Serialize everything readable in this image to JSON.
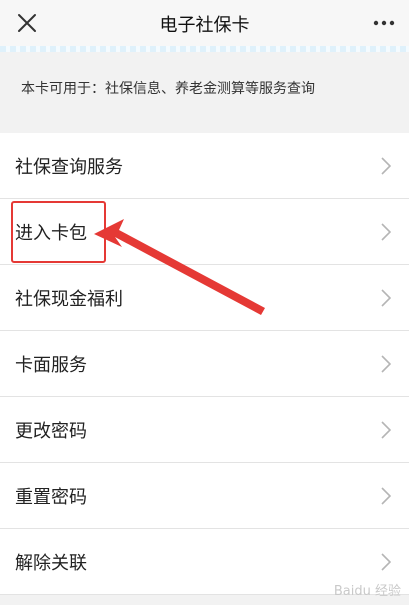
{
  "header": {
    "title": "电子社保卡",
    "close_icon": "close-icon",
    "more_icon": "more-icon"
  },
  "info": {
    "text": "本卡可用于：社保信息、养老金测算等服务查询"
  },
  "menu": {
    "items": [
      {
        "label": "社保查询服务"
      },
      {
        "label": "进入卡包"
      },
      {
        "label": "社保现金福利"
      },
      {
        "label": "卡面服务"
      },
      {
        "label": "更改密码"
      },
      {
        "label": "重置密码"
      },
      {
        "label": "解除关联"
      }
    ]
  },
  "annotation": {
    "color": "#e53935",
    "highlighted_item": "进入卡包"
  },
  "watermark": {
    "text": "Baidu 经验"
  }
}
